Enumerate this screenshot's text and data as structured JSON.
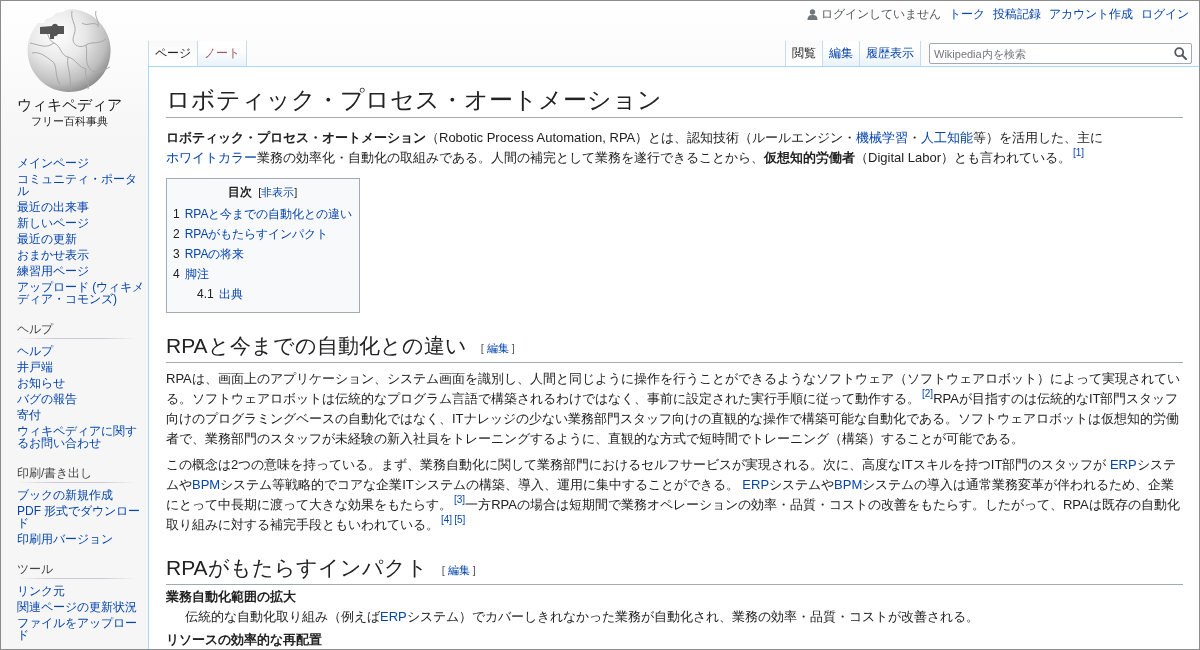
{
  "personal_tools": {
    "status": "ログインしていません",
    "links": [
      "トーク",
      "投稿記録",
      "アカウント作成",
      "ログイン"
    ]
  },
  "logo": {
    "title": "ウィキペディア",
    "tagline": "フリー百科事典"
  },
  "sidebar": {
    "navigation": [
      "メインページ",
      "コミュニティ・ポータル",
      "最近の出来事",
      "新しいページ",
      "最近の更新",
      "おまかせ表示",
      "練習用ページ",
      "アップロード (ウィキメディア・コモンズ)"
    ],
    "portals": [
      {
        "heading": "ヘルプ",
        "links": [
          "ヘルプ",
          "井戸端",
          "お知らせ",
          "バグの報告",
          "寄付",
          "ウィキペディアに関するお問い合わせ"
        ]
      },
      {
        "heading": "印刷/書き出し",
        "links": [
          "ブックの新規作成",
          "PDF 形式でダウンロード",
          "印刷用バージョン"
        ]
      },
      {
        "heading": "ツール",
        "links": [
          "リンク元",
          "関連ページの更新状況",
          "ファイルをアップロード"
        ]
      }
    ]
  },
  "namespace_tabs": [
    {
      "label": "ページ",
      "selected": true,
      "missing_page": false
    },
    {
      "label": "ノート",
      "selected": false,
      "missing_page": true
    }
  ],
  "view_tabs": [
    {
      "label": "閲覧",
      "selected": true
    },
    {
      "label": "編集",
      "selected": false
    },
    {
      "label": "履歴表示",
      "selected": false
    }
  ],
  "search": {
    "placeholder": "Wikipedia内を検索"
  },
  "article": {
    "title": "ロボティック・プロセス・オートメーション",
    "intro": [
      {
        "kind": "bold",
        "text": "ロボティック・プロセス・オートメーション"
      },
      {
        "kind": "text",
        "text": "（Robotic Process Automation, RPA）とは、認知技術（ルールエンジン・"
      },
      {
        "kind": "link",
        "text": "機械学習"
      },
      {
        "kind": "text",
        "text": "・"
      },
      {
        "kind": "link",
        "text": "人工知能"
      },
      {
        "kind": "text",
        "text": "等）を活用した、主に"
      },
      {
        "kind": "link",
        "text": "ホワイトカラー"
      },
      {
        "kind": "text",
        "text": "業務の効率化・自動化の取組みである。人間の補完として業務を遂行できることから、"
      },
      {
        "kind": "bold",
        "text": "仮想知的労働者"
      },
      {
        "kind": "text",
        "text": "（Digital Labor）とも言われている。"
      },
      {
        "kind": "ref",
        "text": "[1]"
      }
    ],
    "toc": {
      "title": "目次",
      "toggle": {
        "open": "[",
        "label": "非表示",
        "close": "]"
      },
      "items": [
        {
          "number": "1",
          "label": "RPAと今までの自動化との違い"
        },
        {
          "number": "2",
          "label": "RPAがもたらすインパクト"
        },
        {
          "number": "3",
          "label": "RPAの将来"
        },
        {
          "number": "4",
          "label": "脚注",
          "children": [
            {
              "number": "4.1",
              "label": "出典"
            }
          ]
        }
      ]
    },
    "sections": [
      {
        "heading": "RPAと今までの自動化との違い",
        "edit": {
          "open": "[",
          "label": "編集",
          "close": "]"
        },
        "paragraphs": [
          [
            {
              "kind": "text",
              "text": "RPAは、画面上のアプリケーション、システム画面を識別し、人間と同じように操作を行うことができるようなソフトウェア（ソフトウェアロボット）によって実現されている。ソフトウェアロボットは伝統的なプログラム言語で構築されるわけではなく、事前に設定された実行手順に従って動作する。"
            },
            {
              "kind": "ref",
              "text": "[2]"
            },
            {
              "kind": "text",
              "text": "RPAが目指すのは伝統的なIT部門スタッフ向けのプログラミングベースの自動化ではなく、ITナレッジの少ない業務部門スタッフ向けの直観的な操作で構築可能な自動化である。ソフトウェアロボットは仮想知的労働者で、業務部門のスタッフが未経験の新入社員をトレーニングするように、直観的な方式で短時間でトレーニング（構築）することが可能である。"
            }
          ],
          [
            {
              "kind": "text",
              "text": "この概念は2つの意味を持っている。まず、業務自動化に関して業務部門におけるセルフサービスが実現される。次に、高度なITスキルを持つIT部門のスタッフが "
            },
            {
              "kind": "link",
              "text": "ERP"
            },
            {
              "kind": "text",
              "text": "システムや"
            },
            {
              "kind": "link",
              "text": "BPM"
            },
            {
              "kind": "text",
              "text": "システム等戦略的でコアな企業ITシステムの構築、導入、運用に集中することができる。 "
            },
            {
              "kind": "link",
              "text": "ERP"
            },
            {
              "kind": "text",
              "text": "システムや"
            },
            {
              "kind": "link",
              "text": "BPM"
            },
            {
              "kind": "text",
              "text": "システムの導入は通常業務変革が伴われるため、企業にとって中長期に渡って大きな効果をもたらす。"
            },
            {
              "kind": "ref",
              "text": "[3]"
            },
            {
              "kind": "text",
              "text": "一方RPAの場合は短期間で業務オペレーションの効率・品質・コストの改善をもたらす。したがって、RPAは既存の自動化取り組みに対する補完手段ともいわれている。"
            },
            {
              "kind": "ref",
              "text": "[4]"
            },
            {
              "kind": "ref",
              "text": "[5]"
            }
          ]
        ]
      },
      {
        "heading": "RPAがもたらすインパクト",
        "edit": {
          "open": "[",
          "label": "編集",
          "close": "]"
        },
        "definitions": [
          {
            "term": "業務自動化範囲の拡大",
            "description": [
              {
                "kind": "text",
                "text": "伝統的な自動化取り組み（例えば"
              },
              {
                "kind": "link",
                "text": "ERP"
              },
              {
                "kind": "text",
                "text": "システム）でカバーしきれなかった業務が自動化され、業務の効率・品質・コストが改善される。"
              }
            ]
          },
          {
            "term": "リソースの効率的な再配置"
          }
        ]
      }
    ]
  }
}
